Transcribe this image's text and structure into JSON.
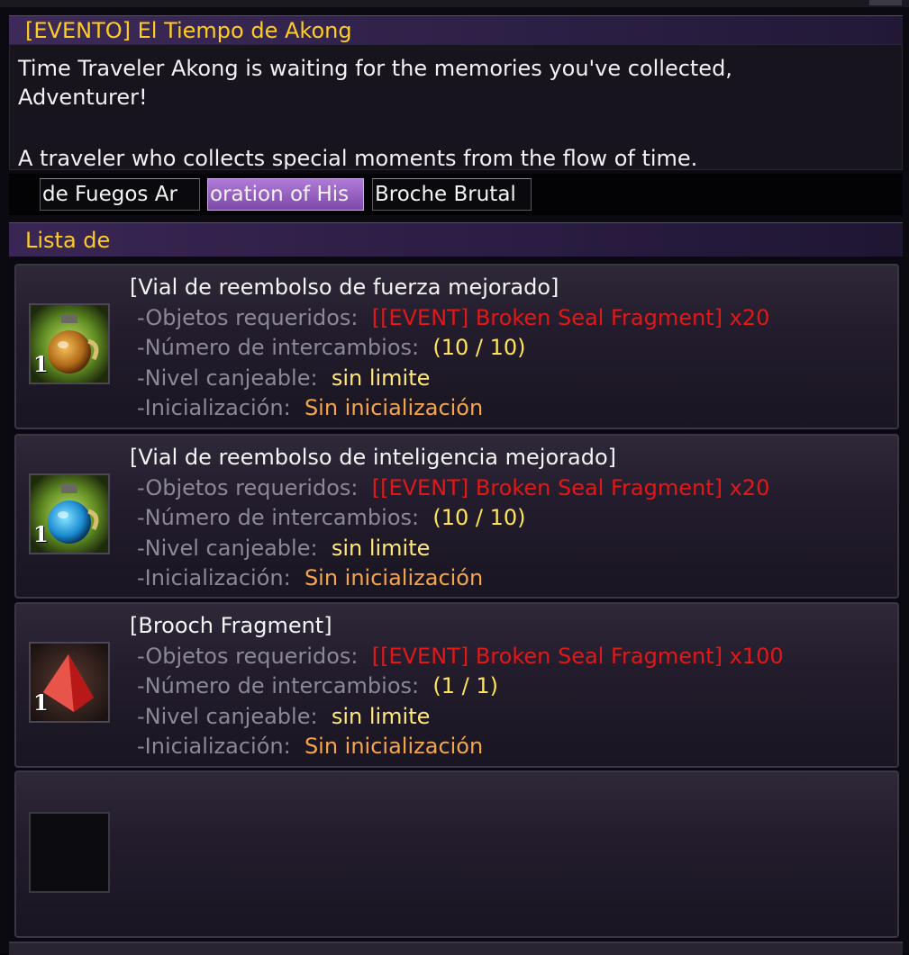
{
  "event": {
    "title": "[EVENTO] El Tiempo de Akong",
    "description_line1": "Time Traveler Akong is waiting for the memories you've collected,",
    "description_line2": "Adventurer!",
    "description_line3": "A traveler who collects special moments from the flow of time."
  },
  "tabs": [
    {
      "label": "de Fuegos Ar",
      "active": false
    },
    {
      "label": "oration of His",
      "active": true
    },
    {
      "label": "Broche Brutal",
      "active": false
    }
  ],
  "list": {
    "header": "Lista de",
    "labels": {
      "required": "-Objetos requeridos:",
      "exchanges": "-Número de intercambios:",
      "level": "-Nivel canjeable:",
      "init": "-Inicialización:"
    },
    "items": [
      {
        "name": "[Vial de reembolso de fuerza mejorado]",
        "required": "[[EVENT] Broken Seal Fragment] x20",
        "exchanges": "(10 / 10)",
        "level": "sin limite",
        "init": "Sin inicialización",
        "qty": "1",
        "icon": "orange-potion-icon"
      },
      {
        "name": "[Vial de reembolso de inteligencia mejorado]",
        "required": "[[EVENT] Broken Seal Fragment] x20",
        "exchanges": "(10 / 10)",
        "level": "sin limite",
        "init": "Sin inicialización",
        "qty": "1",
        "icon": "blue-potion-icon"
      },
      {
        "name": "[Brooch Fragment]",
        "required": "[[EVENT] Broken Seal Fragment] x100",
        "exchanges": "(1 / 1)",
        "level": "sin limite",
        "init": "Sin inicialización",
        "qty": "1",
        "icon": "red-crystal-fragment-icon"
      }
    ]
  },
  "colors": {
    "title_gold": "#ffcc22",
    "required_red": "#e21818",
    "count_yellow": "#ffe45a",
    "init_orange": "#f5a64a",
    "tab_active_purple": "#9a62c4"
  }
}
